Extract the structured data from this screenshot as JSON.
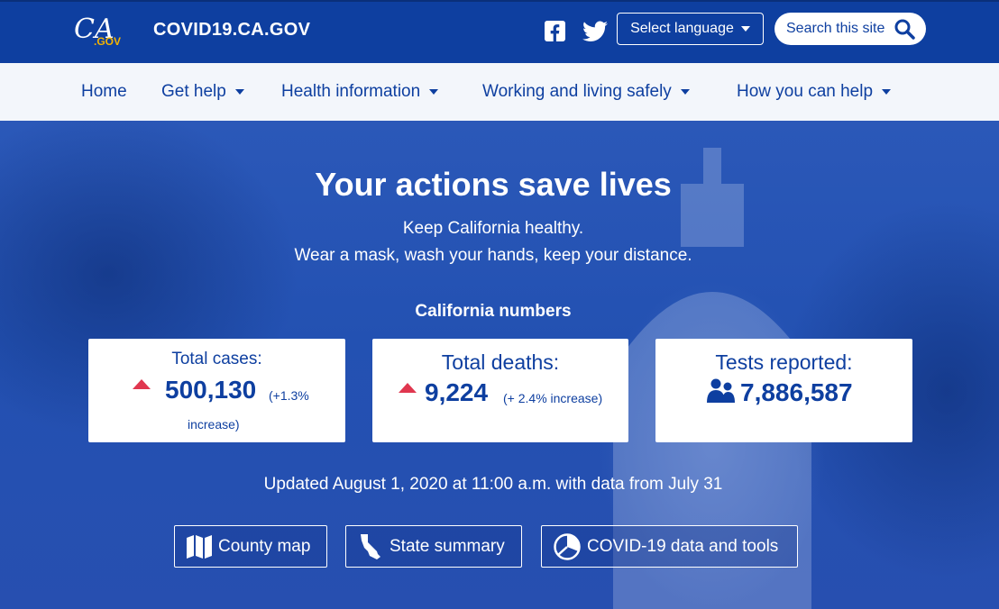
{
  "header": {
    "logo_text": "CA.GOV",
    "site_title": "COVID19.CA.GOV",
    "language_label": "Select language",
    "search_label": "Search this site",
    "social": [
      "facebook-icon",
      "twitter-icon"
    ]
  },
  "nav": {
    "items": [
      {
        "label": "Home",
        "dropdown": false
      },
      {
        "label": "Get help",
        "dropdown": true
      },
      {
        "label": "Health information",
        "dropdown": true
      },
      {
        "label": "Working and living safely",
        "dropdown": true
      },
      {
        "label": "How you can help",
        "dropdown": true
      }
    ]
  },
  "hero": {
    "title": "Your actions save lives",
    "line1": "Keep California healthy.",
    "line2": "Wear a mask, wash your hands, keep your distance.",
    "numbers_heading": "California numbers",
    "cards": [
      {
        "label": "Total cases:",
        "value": "500,130",
        "change_a": "(+1.3%",
        "change_b": "increase)",
        "icon": "trend-up-icon"
      },
      {
        "label": "Total deaths:",
        "value": "9,224",
        "change": "(+ 2.4% increase)",
        "icon": "trend-up-icon"
      },
      {
        "label": "Tests reported:",
        "value": "7,886,587",
        "icon": "people-icon"
      }
    ],
    "updated": "Updated August 1, 2020 at 11:00 a.m. with data from July 31",
    "buttons": [
      {
        "label": "County map",
        "icon": "map-icon"
      },
      {
        "label": "State summary",
        "icon": "california-icon"
      },
      {
        "label": "COVID-19 data and tools",
        "icon": "pie-chart-icon"
      }
    ]
  },
  "colors": {
    "brand_blue": "#0e3fa0",
    "nav_bg": "#f3f6fb",
    "alert_red": "#e0374f",
    "logo_gold": "#f4b400"
  }
}
